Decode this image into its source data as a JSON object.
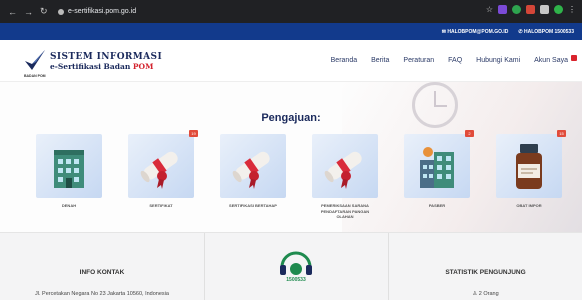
{
  "browser": {
    "url": "e-sertifikasi.pom.go.id"
  },
  "topbar": {
    "email": "HALOBPOM@POM.GO.ID",
    "phone": "HALOBPOM 1500533"
  },
  "header": {
    "title_line1": "SISTEM INFORMASI",
    "title_line2_prefix": "e-Sertifikasi Badan ",
    "title_line2_accent": "POM",
    "logo_caption": "BADAN POM",
    "menu": [
      "Beranda",
      "Berita",
      "Peraturan",
      "FAQ",
      "Hubungi Kami",
      "Akun Saya"
    ]
  },
  "main": {
    "heading": "Pengajuan:",
    "cards": [
      {
        "label": "DENAH",
        "badge": "",
        "icon": "building-icon"
      },
      {
        "label": "SERTIFIKAT",
        "badge": "19",
        "icon": "certificate-scroll-icon"
      },
      {
        "label": "SERTIFIKASI BERTAHAP",
        "badge": "",
        "icon": "certificate-scroll-icon"
      },
      {
        "label": "PEMERIKSAAN SARANA PENDAFTARAN PANGAN OLAHAN",
        "badge": "",
        "icon": "certificate-scroll-icon"
      },
      {
        "label": "PASBER",
        "badge": "2",
        "icon": "building-icon"
      },
      {
        "label": "OBAT IMPOR",
        "badge": "15",
        "icon": "medicine-bottle-icon"
      }
    ]
  },
  "footer": {
    "info_title": "INFO KONTAK",
    "address": "Jl. Percetakan Negara No 23 Jakarta 10560, Indonesia",
    "callcenter_number": "1500533",
    "stats_title": "STATISTIK PENGUNJUNG",
    "stats_value": "2 Orang"
  },
  "colors": {
    "topbar": "#123a8c",
    "brand_navy": "#1b2a5c",
    "accent_red": "#d3232e",
    "badge_red": "#e14b3a"
  }
}
